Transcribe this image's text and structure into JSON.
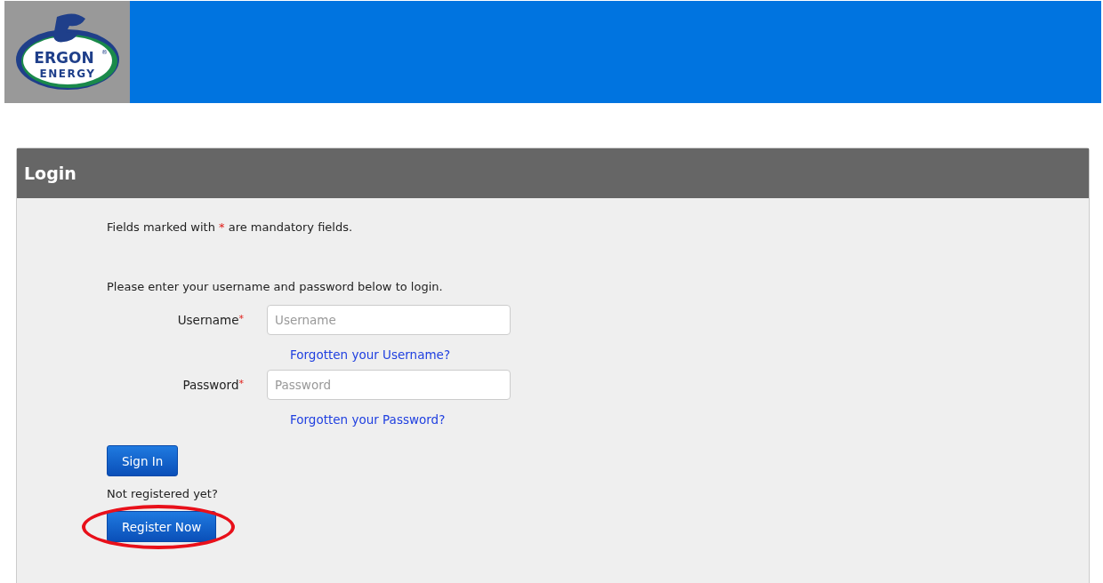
{
  "logo": {
    "lines": [
      "ERGON",
      "ENERGY"
    ],
    "mark": "®"
  },
  "panel": {
    "title": "Login"
  },
  "mandatory_note": {
    "before": "Fields marked with",
    "mark": "*",
    "after": "are mandatory fields."
  },
  "instruction": "Please enter your username and password below to login.",
  "fields": [
    {
      "label": "Username",
      "required_mark": "*",
      "placeholder": "Username",
      "link": "Forgotten your Username?"
    },
    {
      "label": "Password",
      "required_mark": "*",
      "placeholder": "Password",
      "link": "Forgotten your Password?"
    }
  ],
  "sign_in_button": "Sign In",
  "register_prompt": "Not registered yet?",
  "register_button": {
    "label": "Register Now",
    "highlighted": true
  }
}
